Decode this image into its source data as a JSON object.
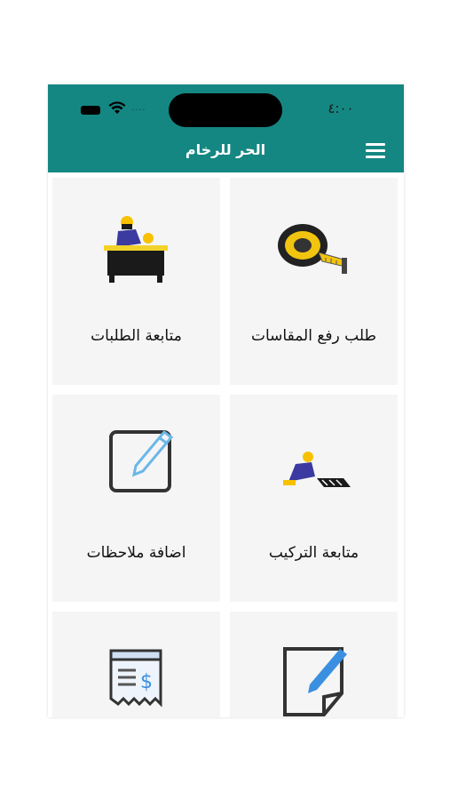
{
  "status_bar": {
    "time": "٤:٠٠",
    "signal_text": "...."
  },
  "header": {
    "title": "الحر للرخام"
  },
  "cards": [
    {
      "label": "طلب رفع المقاسات"
    },
    {
      "label": "متابعة الطلبات"
    },
    {
      "label": "متابعة التركيب"
    },
    {
      "label": "اضافة ملاحظات"
    },
    {
      "label": ""
    },
    {
      "label": ""
    }
  ],
  "colors": {
    "header_bg": "#158782",
    "card_bg": "#f5f5f5",
    "icon_blue": "#6ab7e8"
  }
}
